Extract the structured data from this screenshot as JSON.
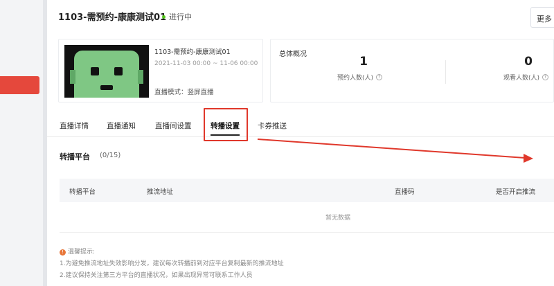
{
  "header": {
    "title": "1103-需预约-康康测试01",
    "status": "进行中",
    "more_label": "更多"
  },
  "live_card": {
    "title": "1103-需预约-康康测试01",
    "date_range": "2021-11-03 00:00 ~ 11-06 00:00",
    "mode": "直播模式：竖屏直播"
  },
  "overview": {
    "title": "总体概况",
    "reservations": {
      "value": "1",
      "label": "预约人数(人)"
    },
    "viewers": {
      "value": "0",
      "label": "观看人数(人)"
    }
  },
  "tabs": [
    {
      "label": "直播详情"
    },
    {
      "label": "直播通知"
    },
    {
      "label": "直播间设置"
    },
    {
      "label": "转播设置",
      "active": true
    },
    {
      "label": "卡券推送"
    }
  ],
  "section": {
    "title": "转播平台",
    "count": "(0/15)"
  },
  "table": {
    "headers": [
      "转播平台",
      "推流地址",
      "直播码",
      "是否开启推流"
    ],
    "empty_text": "暂无数据"
  },
  "tips": {
    "title": "温馨提示:",
    "lines": [
      "1.为避免推流地址失效影响分发，建议每次转播前到对应平台复制最新的推流地址",
      "2.建议保持关注第三方平台的直播状况，如果出现异常可联系工作人员"
    ]
  },
  "colors": {
    "accent_red": "#e0382b",
    "status_green": "#52c41a",
    "warn_orange": "#e8773a"
  }
}
